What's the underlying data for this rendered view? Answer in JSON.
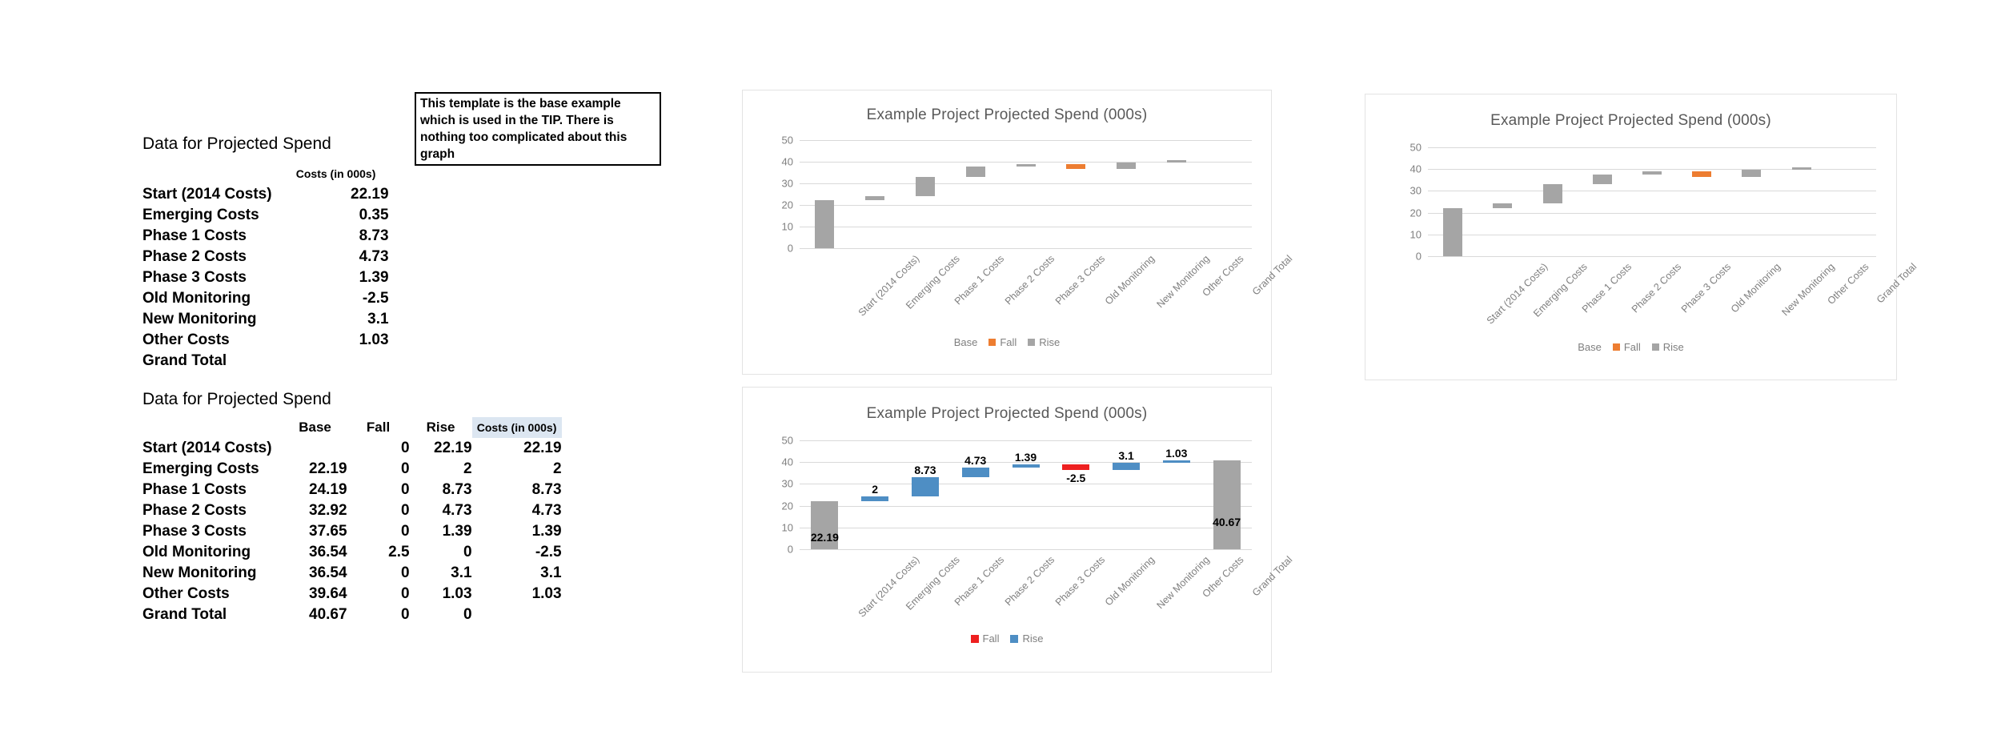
{
  "table1": {
    "title": "Data for Projected Spend",
    "header": "Costs (in 000s)",
    "rows": [
      {
        "label": "Start (2014 Costs)",
        "cost": "22.19"
      },
      {
        "label": "Emerging Costs",
        "cost": "0.35"
      },
      {
        "label": "Phase 1 Costs",
        "cost": "8.73"
      },
      {
        "label": "Phase 2 Costs",
        "cost": "4.73"
      },
      {
        "label": "Phase 3 Costs",
        "cost": "1.39"
      },
      {
        "label": "Old Monitoring",
        "cost": "-2.5"
      },
      {
        "label": "New Monitoring",
        "cost": "3.1"
      },
      {
        "label": "Other Costs",
        "cost": "1.03"
      },
      {
        "label": "Grand Total",
        "cost": ""
      }
    ]
  },
  "table2": {
    "title": "Data for Projected Spend",
    "headers": [
      "",
      "Base",
      "Fall",
      "Rise",
      "Costs (in 000s)"
    ],
    "rows": [
      {
        "label": "Start (2014 Costs)",
        "base": "",
        "fall": "0",
        "rise": "22.19",
        "cost": "22.19"
      },
      {
        "label": "Emerging Costs",
        "base": "22.19",
        "fall": "0",
        "rise": "2",
        "cost": "2"
      },
      {
        "label": "Phase 1 Costs",
        "base": "24.19",
        "fall": "0",
        "rise": "8.73",
        "cost": "8.73"
      },
      {
        "label": "Phase 2 Costs",
        "base": "32.92",
        "fall": "0",
        "rise": "4.73",
        "cost": "4.73"
      },
      {
        "label": "Phase 3 Costs",
        "base": "37.65",
        "fall": "0",
        "rise": "1.39",
        "cost": "1.39"
      },
      {
        "label": "Old Monitoring",
        "base": "36.54",
        "fall": "2.5",
        "rise": "0",
        "cost": "-2.5"
      },
      {
        "label": "New Monitoring",
        "base": "36.54",
        "fall": "0",
        "rise": "3.1",
        "cost": "3.1"
      },
      {
        "label": "Other Costs",
        "base": "39.64",
        "fall": "0",
        "rise": "1.03",
        "cost": "1.03"
      },
      {
        "label": "Grand Total",
        "base": "40.67",
        "fall": "0",
        "rise": "0",
        "cost": ""
      }
    ]
  },
  "note": {
    "text": "This template is the base example which is used in the TIP. There is nothing too complicated about this graph"
  },
  "colors": {
    "gray": "#a5a5a5",
    "orange": "#ed7d31",
    "blue": "#4e8ec4",
    "red": "#ee2020",
    "gridline": "#d9d9d9",
    "axis_text": "#7f7f7f",
    "title_text": "#595959",
    "panel_border": "#e3e3e3",
    "header_highlight": "#dce6f1"
  },
  "chart_data": [
    {
      "id": "chart-top-middle",
      "type": "bar",
      "title": "Example Project Projected Spend (000s)",
      "xlabel": "",
      "ylabel": "",
      "ylim": [
        0,
        50
      ],
      "yticks": [
        "0",
        "10",
        "20",
        "30",
        "40",
        "50"
      ],
      "grid": true,
      "legend_position": "bottom",
      "legend": [
        {
          "name": "Base",
          "color": "none"
        },
        {
          "name": "Fall",
          "color": "#ed7d31"
        },
        {
          "name": "Rise",
          "color": "#a5a5a5"
        }
      ],
      "categories": [
        "Start (2014 Costs)",
        "Emerging Costs",
        "Phase 1 Costs",
        "Phase 2 Costs",
        "Phase 3 Costs",
        "Old Monitoring",
        "New Monitoring",
        "Other Costs",
        "Grand Total"
      ],
      "series": [
        {
          "name": "Base",
          "values": [
            0,
            22.19,
            24.19,
            32.92,
            37.65,
            36.54,
            36.54,
            39.64,
            40.67
          ]
        },
        {
          "name": "Fall",
          "values": [
            0,
            0,
            0,
            0,
            0,
            2.5,
            0,
            0,
            0
          ]
        },
        {
          "name": "Rise",
          "values": [
            22.19,
            2,
            8.73,
            4.73,
            1.39,
            0,
            3.1,
            1.03,
            0
          ]
        }
      ],
      "bars": [
        {
          "category": "Start (2014 Costs)",
          "base": 0,
          "top": 22.19,
          "color": "gray"
        },
        {
          "category": "Emerging Costs",
          "base": 22.19,
          "top": 24.19,
          "color": "gray"
        },
        {
          "category": "Phase 1 Costs",
          "base": 24.19,
          "top": 32.92,
          "color": "gray"
        },
        {
          "category": "Phase 2 Costs",
          "base": 32.92,
          "top": 37.65,
          "color": "gray"
        },
        {
          "category": "Phase 3 Costs",
          "base": 37.65,
          "top": 39.04,
          "color": "gray"
        },
        {
          "category": "Old Monitoring",
          "base": 36.54,
          "top": 39.04,
          "color": "orange"
        },
        {
          "category": "New Monitoring",
          "base": 36.54,
          "top": 39.64,
          "color": "gray"
        },
        {
          "category": "Other Costs",
          "base": 39.64,
          "top": 40.67,
          "color": "gray"
        },
        {
          "category": "Grand Total",
          "base": 0,
          "top": 0,
          "color": "gray"
        }
      ],
      "data_labels": []
    },
    {
      "id": "chart-right",
      "type": "bar",
      "title": "Example Project Projected Spend (000s)",
      "xlabel": "",
      "ylabel": "",
      "ylim": [
        0,
        50
      ],
      "yticks": [
        "0",
        "10",
        "20",
        "30",
        "40",
        "50"
      ],
      "grid": true,
      "legend_position": "bottom",
      "legend": [
        {
          "name": "Base",
          "color": "none"
        },
        {
          "name": "Fall",
          "color": "#ed7d31"
        },
        {
          "name": "Rise",
          "color": "#a5a5a5"
        }
      ],
      "categories": [
        "Start (2014 Costs)",
        "Emerging Costs",
        "Phase 1 Costs",
        "Phase 2 Costs",
        "Phase 3 Costs",
        "Old Monitoring",
        "New Monitoring",
        "Other Costs",
        "Grand Total"
      ],
      "series": [
        {
          "name": "Base",
          "values": [
            0,
            22.19,
            24.19,
            32.92,
            37.65,
            36.54,
            36.54,
            39.64,
            40.67
          ]
        },
        {
          "name": "Fall",
          "values": [
            0,
            0,
            0,
            0,
            0,
            2.5,
            0,
            0,
            0
          ]
        },
        {
          "name": "Rise",
          "values": [
            22.19,
            2,
            8.73,
            4.73,
            1.39,
            0,
            3.1,
            1.03,
            0
          ]
        }
      ],
      "bars": [
        {
          "category": "Start (2014 Costs)",
          "base": 0,
          "top": 22.19,
          "color": "gray"
        },
        {
          "category": "Emerging Costs",
          "base": 22.19,
          "top": 24.19,
          "color": "gray"
        },
        {
          "category": "Phase 1 Costs",
          "base": 24.19,
          "top": 32.92,
          "color": "gray"
        },
        {
          "category": "Phase 2 Costs",
          "base": 32.92,
          "top": 37.65,
          "color": "gray"
        },
        {
          "category": "Phase 3 Costs",
          "base": 37.65,
          "top": 39.04,
          "color": "gray"
        },
        {
          "category": "Old Monitoring",
          "base": 36.54,
          "top": 39.04,
          "color": "orange"
        },
        {
          "category": "New Monitoring",
          "base": 36.54,
          "top": 39.64,
          "color": "gray"
        },
        {
          "category": "Other Costs",
          "base": 39.64,
          "top": 40.67,
          "color": "gray"
        },
        {
          "category": "Grand Total",
          "base": 0,
          "top": 0,
          "color": "gray"
        }
      ],
      "data_labels": []
    },
    {
      "id": "chart-bottom-middle",
      "type": "bar",
      "title": "Example Project Projected Spend (000s)",
      "xlabel": "",
      "ylabel": "",
      "ylim": [
        0,
        50
      ],
      "yticks": [
        "0",
        "10",
        "20",
        "30",
        "40",
        "50"
      ],
      "grid": true,
      "legend_position": "bottom",
      "legend": [
        {
          "name": "Fall",
          "color": "#ee2020"
        },
        {
          "name": "Rise",
          "color": "#4e8ec4"
        }
      ],
      "categories": [
        "Start (2014 Costs)",
        "Emerging Costs",
        "Phase 1 Costs",
        "Phase 2 Costs",
        "Phase 3 Costs",
        "Old Monitoring",
        "New Monitoring",
        "Other Costs",
        "Grand Total"
      ],
      "series": [
        {
          "name": "Base",
          "values": [
            0,
            22.19,
            24.19,
            32.92,
            37.65,
            36.54,
            36.54,
            39.64,
            40.67
          ]
        },
        {
          "name": "Fall",
          "values": [
            0,
            0,
            0,
            0,
            0,
            2.5,
            0,
            0,
            0
          ]
        },
        {
          "name": "Rise",
          "values": [
            22.19,
            2,
            8.73,
            4.73,
            1.39,
            0,
            3.1,
            1.03,
            0
          ]
        }
      ],
      "bars": [
        {
          "category": "Start (2014 Costs)",
          "base": 0,
          "top": 22.19,
          "color": "gray",
          "label": "22.19",
          "label_pos": "inside"
        },
        {
          "category": "Emerging Costs",
          "base": 22.19,
          "top": 24.19,
          "color": "blue",
          "label": "2",
          "label_pos": "above"
        },
        {
          "category": "Phase 1 Costs",
          "base": 24.19,
          "top": 32.92,
          "color": "blue",
          "label": "8.73",
          "label_pos": "above"
        },
        {
          "category": "Phase 2 Costs",
          "base": 32.92,
          "top": 37.65,
          "color": "blue",
          "label": "4.73",
          "label_pos": "above"
        },
        {
          "category": "Phase 3 Costs",
          "base": 37.65,
          "top": 39.04,
          "color": "blue",
          "label": "1.39",
          "label_pos": "above"
        },
        {
          "category": "Old Monitoring",
          "base": 36.54,
          "top": 39.04,
          "color": "red",
          "label": "-2.5",
          "label_pos": "below"
        },
        {
          "category": "New Monitoring",
          "base": 36.54,
          "top": 39.64,
          "color": "blue",
          "label": "3.1",
          "label_pos": "above"
        },
        {
          "category": "Other Costs",
          "base": 39.64,
          "top": 40.67,
          "color": "blue",
          "label": "1.03",
          "label_pos": "above"
        },
        {
          "category": "Grand Total",
          "base": 0,
          "top": 40.67,
          "color": "gray",
          "label": "40.67",
          "label_pos": "inside"
        }
      ],
      "data_labels": [
        "22.19",
        "2",
        "8.73",
        "4.73",
        "1.39",
        "-2.5",
        "3.1",
        "1.03",
        "40.67"
      ]
    }
  ]
}
